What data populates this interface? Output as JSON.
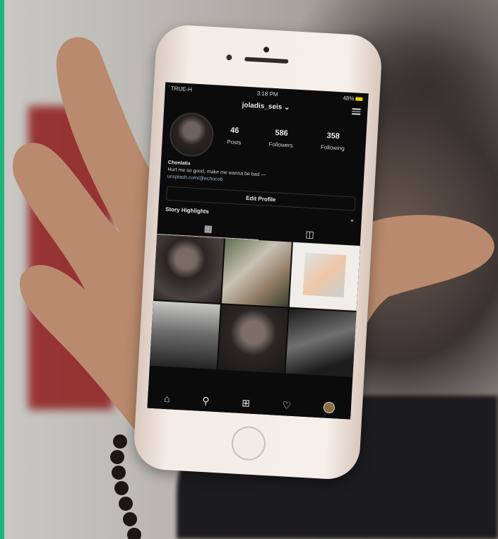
{
  "status_bar": {
    "carrier": "TRUE-H",
    "time": "3:18 PM",
    "battery": "48%"
  },
  "profile": {
    "username": "joladis_seis",
    "posts": {
      "count": "46",
      "label": "Posts"
    },
    "followers": {
      "count": "586",
      "label": "Followers"
    },
    "following": {
      "count": "358",
      "label": "Following"
    },
    "display_name": "Chonlatis",
    "bio_line": "Hurt me so good, make me wanna be bad —",
    "link": "unsplash.com/@echocob",
    "edit_label": "Edit Profile",
    "highlights_label": "Story Highlights"
  },
  "icons": {
    "grid_tab": "grid-icon",
    "tagged_tab": "tagged-icon",
    "nav": [
      "home-icon",
      "search-icon",
      "add-post-icon",
      "heart-icon",
      "profile-icon"
    ]
  }
}
